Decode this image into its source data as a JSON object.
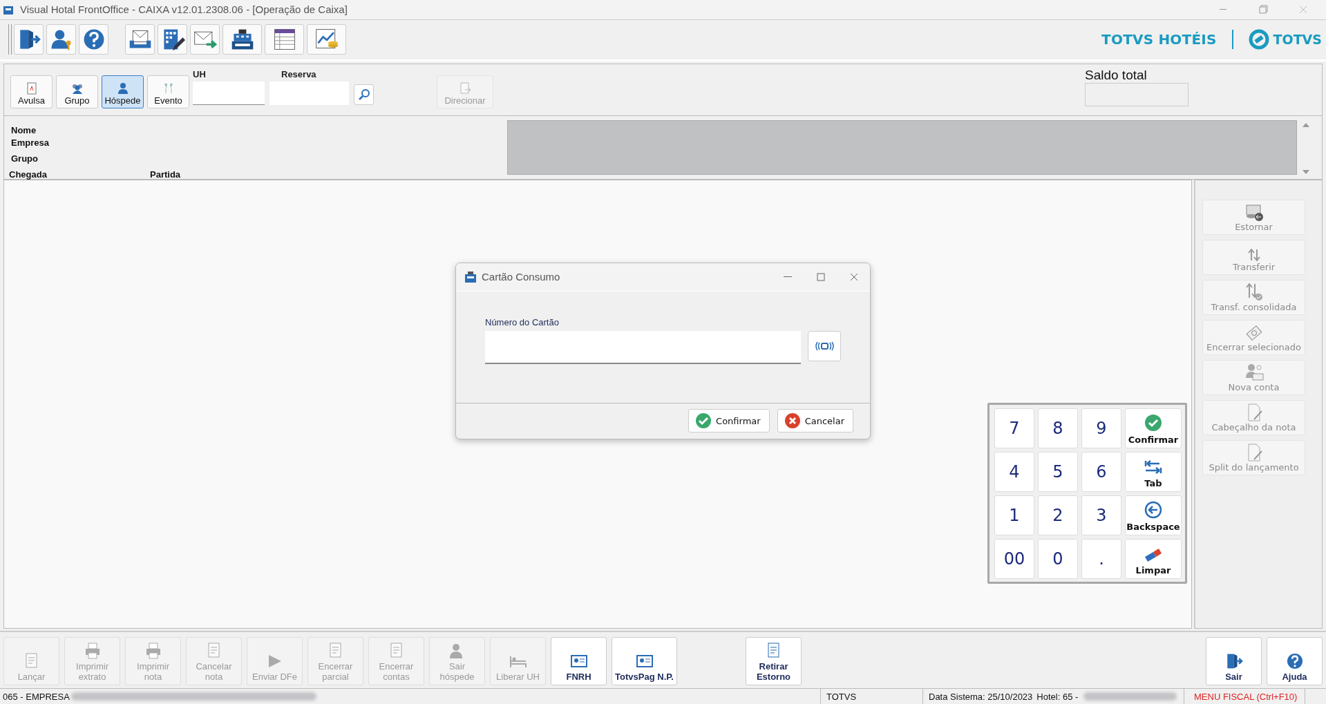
{
  "window": {
    "title": "Visual Hotal FrontOffice - CAIXA v12.01.2308.06 - [Operação de Caixa]"
  },
  "branding": {
    "product": "TOTVS HOTÉIS",
    "company": "TOTVS"
  },
  "account_type": {
    "buttons": [
      {
        "label": "Avulsa",
        "selected": false
      },
      {
        "label": "Grupo",
        "selected": false
      },
      {
        "label": "Hóspede",
        "selected": true
      },
      {
        "label": "Evento",
        "selected": false
      }
    ],
    "uh_label": "UH",
    "reserva_label": "Reserva",
    "direct_button": {
      "label": "Direcionar",
      "disabled": true
    },
    "balance_label": "Saldo total"
  },
  "guest_info": {
    "name_label": "Nome",
    "company_label": "Empresa",
    "group_label": "Grupo",
    "arrival_label": "Chegada",
    "departure_label": "Partida"
  },
  "sidebar": {
    "buttons": [
      {
        "label": "Estornar",
        "disabled": true
      },
      {
        "label": "Transferir",
        "disabled": true
      },
      {
        "label": "Transf. consolidada",
        "disabled": true
      },
      {
        "label": "Encerrar selecionado",
        "disabled": true
      },
      {
        "label": "Nova conta",
        "disabled": true
      },
      {
        "label": "Cabeçalho da nota",
        "disabled": true
      },
      {
        "label": "Split do lançamento",
        "disabled": true
      }
    ]
  },
  "keypad": {
    "keys": [
      {
        "label": "7",
        "kind": "digit"
      },
      {
        "label": "8",
        "kind": "digit"
      },
      {
        "label": "9",
        "kind": "digit"
      },
      {
        "label": "Confirmar",
        "kind": "confirm"
      },
      {
        "label": "4",
        "kind": "digit"
      },
      {
        "label": "5",
        "kind": "digit"
      },
      {
        "label": "6",
        "kind": "digit"
      },
      {
        "label": "Tab",
        "kind": "tab"
      },
      {
        "label": "1",
        "kind": "digit"
      },
      {
        "label": "2",
        "kind": "digit"
      },
      {
        "label": "3",
        "kind": "digit"
      },
      {
        "label": "Backspace",
        "kind": "backspace"
      },
      {
        "label": "00",
        "kind": "digit"
      },
      {
        "label": "0",
        "kind": "digit"
      },
      {
        "label": ".",
        "kind": "digit"
      },
      {
        "label": "Limpar",
        "kind": "clear"
      }
    ]
  },
  "dialog": {
    "title": "Cartão Consumo",
    "field_label": "Número do Cartão",
    "buttons": [
      {
        "label": "Confirmar",
        "kind": "confirm"
      },
      {
        "label": "Cancelar",
        "kind": "cancel"
      }
    ]
  },
  "bottom_toolbar": {
    "buttons": [
      {
        "label": "Lançar",
        "disabled": true
      },
      {
        "label": "Imprimir\nextrato",
        "disabled": true
      },
      {
        "label": "Imprimir\nnota",
        "disabled": true
      },
      {
        "label": "Cancelar\nnota",
        "disabled": true
      },
      {
        "label": "Enviar DFe",
        "disabled": true
      },
      {
        "label": "Encerrar\nparcial",
        "disabled": true
      },
      {
        "label": "Encerrar\ncontas",
        "disabled": true
      },
      {
        "label": "Sair\nhóspede",
        "disabled": true
      },
      {
        "label": "Liberar UH",
        "disabled": true
      },
      {
        "label": "FNRH",
        "disabled": false
      },
      {
        "label": "TotvsPag N.P.",
        "disabled": false
      },
      {
        "label": "Retirar\nEstorno",
        "disabled": false
      }
    ],
    "right_buttons": [
      {
        "label": "Sair"
      },
      {
        "label": "Ajuda"
      }
    ]
  },
  "status_bar": {
    "company": "065 - EMPRESA",
    "system": "TOTVS",
    "date": "Data Sistema: 25/10/2023",
    "hotel": "Hotel: 65 -",
    "fiscal_menu": "MENU FISCAL (Ctrl+F10)"
  }
}
